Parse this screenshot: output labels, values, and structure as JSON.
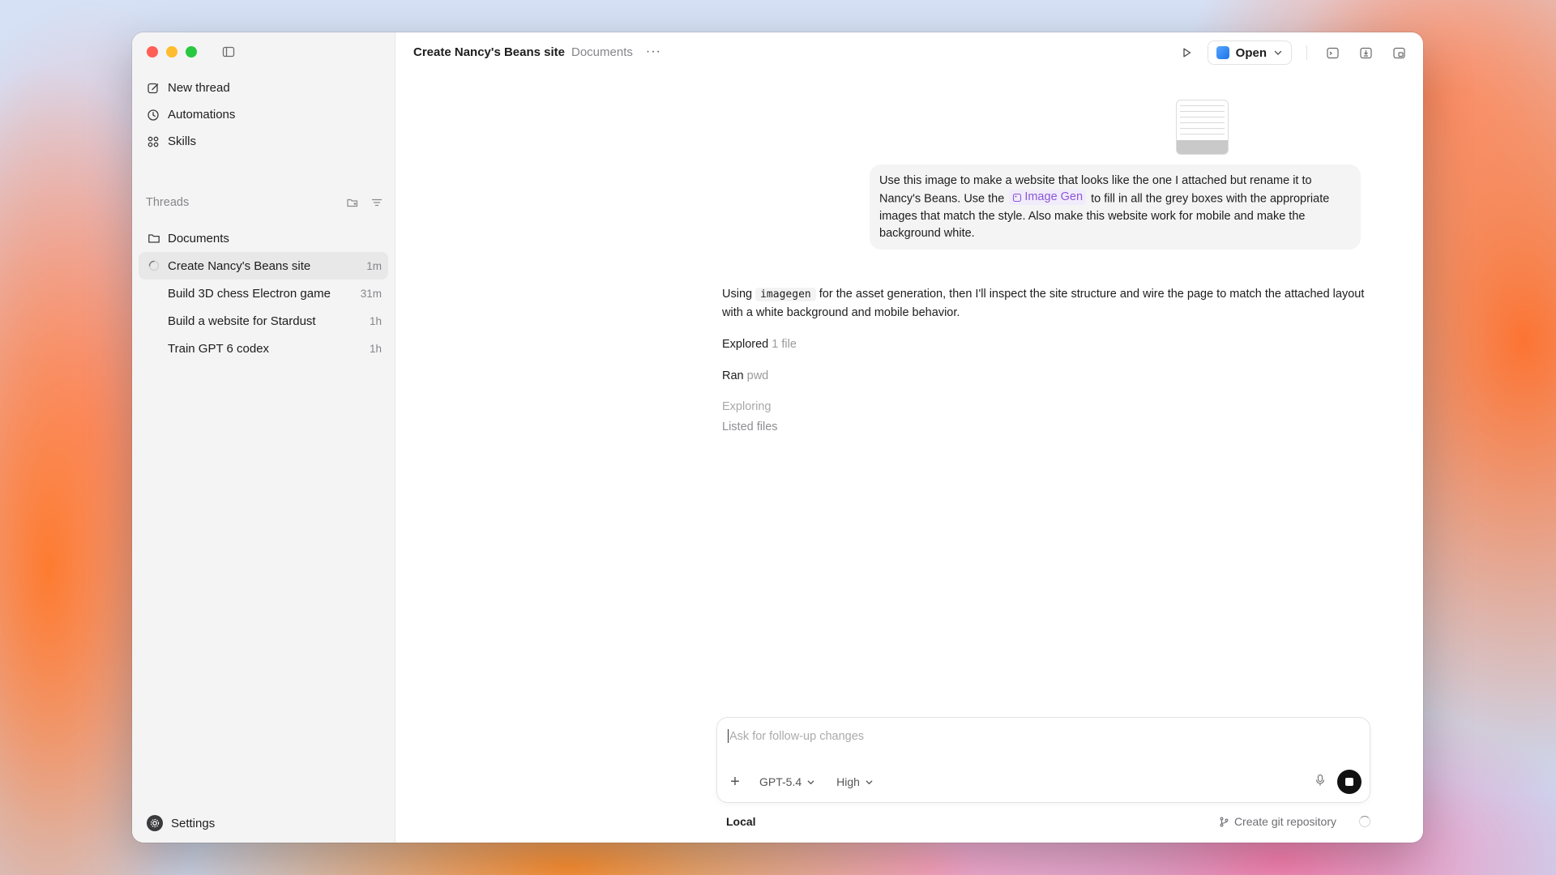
{
  "sidebar": {
    "nav": [
      {
        "label": "New thread",
        "icon": "edit-icon"
      },
      {
        "label": "Automations",
        "icon": "clock-icon"
      },
      {
        "label": "Skills",
        "icon": "grid-icon"
      }
    ],
    "threads_label": "Threads",
    "folder_label": "Documents",
    "threads": [
      {
        "title": "Create Nancy's Beans site",
        "time": "1m",
        "active": true
      },
      {
        "title": "Build 3D chess Electron game",
        "time": "31m"
      },
      {
        "title": "Build a website for Stardust",
        "time": "1h"
      },
      {
        "title": "Train GPT 6 codex",
        "time": "1h"
      }
    ],
    "settings_label": "Settings"
  },
  "header": {
    "title": "Create Nancy's Beans site",
    "crumb": "Documents",
    "more": "···",
    "open_label": "Open"
  },
  "conversation": {
    "user_message": {
      "part1": "Use this image to make a website that looks like the one I attached but rename it to Nancy's Beans. Use the",
      "pill": "Image Gen",
      "part2": "to fill in all the grey boxes with the appropriate images that match the style. Also make this website work for mobile and make the background white."
    },
    "assistant": {
      "pre": "Using",
      "code": "imagegen",
      "post": "for the asset generation, then I'll inspect the site structure and wire the page to match the attached layout with a white background and mobile behavior."
    },
    "steps": [
      {
        "verb": "Explored",
        "detail": "1 file"
      },
      {
        "verb": "Ran",
        "detail": "pwd"
      },
      {
        "verb": "Exploring",
        "detail": ""
      },
      {
        "verb": "Listed files",
        "detail": ""
      }
    ]
  },
  "composer": {
    "placeholder": "Ask for follow-up changes",
    "model": "GPT-5.4",
    "effort": "High"
  },
  "footer": {
    "env": "Local",
    "git": "Create git repository"
  },
  "colors": {
    "accent_pill": "#8b57d6",
    "traffic_red": "#fe5f57",
    "traffic_yellow": "#febc2e",
    "traffic_green": "#28c840"
  }
}
